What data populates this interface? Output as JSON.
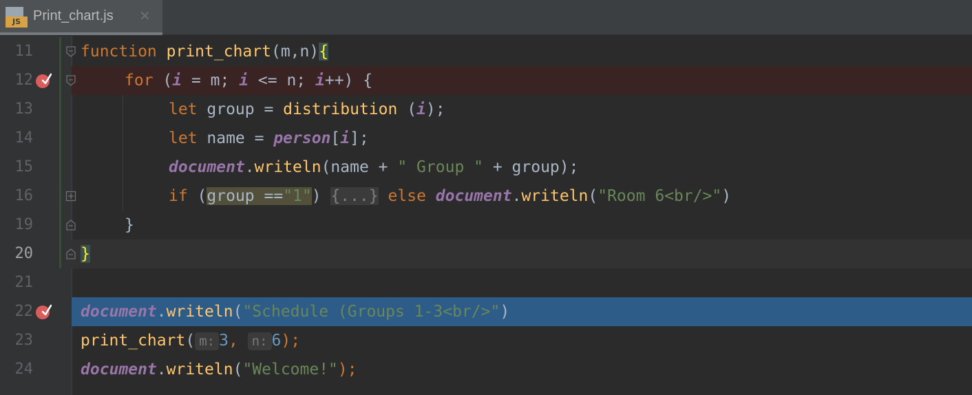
{
  "tab": {
    "title": "Print_chart.js",
    "close": "✕",
    "icon_text": "JS"
  },
  "lines": {
    "l11": {
      "num": "11"
    },
    "l12": {
      "num": "12"
    },
    "l13": {
      "num": "13"
    },
    "l14": {
      "num": "14"
    },
    "l15": {
      "num": "15"
    },
    "l16": {
      "num": "16"
    },
    "l19": {
      "num": "19"
    },
    "l20": {
      "num": "20"
    },
    "l21": {
      "num": "21"
    },
    "l22": {
      "num": "22"
    },
    "l23": {
      "num": "23"
    },
    "l24": {
      "num": "24"
    }
  },
  "code": {
    "l11": {
      "kw": "function",
      "fn": "print_chart",
      "rest": "(m,n)",
      "brace": "{"
    },
    "l12": {
      "kw": "for",
      "p1": " (",
      "v1": "i",
      "p2": " = m; ",
      "v2": "i",
      "p3": " <= n; ",
      "v3": "i",
      "p4": "++) {"
    },
    "l13": {
      "kw": "let",
      "p1": " group = ",
      "fn": "distribution",
      "p2": " (",
      "v": "i",
      "p3": ");"
    },
    "l14": {
      "kw": "let",
      "p1": " name = ",
      "v1": "person",
      "p2": "[",
      "v2": "i",
      "p3": "];"
    },
    "l15": {
      "v": "document",
      "p1": ".",
      "fn": "writeln",
      "p2": "(name + ",
      "str": "\" Group \"",
      "p3": " + group);"
    },
    "l16": {
      "kw": "if",
      "p1": " (",
      "hl": "group ==",
      "str": "\"1\"",
      "p2": ") ",
      "fold": "{...}",
      "p3": " ",
      "kw2": "else",
      "p4": " ",
      "v": "document",
      "p5": ".",
      "fn": "writeln",
      "p6": "(",
      "str2": "\"Room 6<br/>\"",
      "p7": ")"
    },
    "l19": {
      "text": "}"
    },
    "l20": {
      "brace": "}"
    },
    "l22": {
      "v": "document",
      "p1": ".",
      "fn": "writeln",
      "p2": "(",
      "str": "\"Schedule (Groups 1-3<br/>\"",
      "p3": ")"
    },
    "l23": {
      "fn": "print_chart",
      "p1": "(",
      "hint1": "m:",
      "n1": "3",
      "p2": ", ",
      "hint2": "n:",
      "n2": "6",
      "p3": ");"
    },
    "l24": {
      "v": "document",
      "p1": ".",
      "fn": "writeln",
      "p2": "(",
      "str": "\"Welcome!\"",
      "p3": ");"
    }
  },
  "colors": {
    "keyword": "#cc7832",
    "function": "#ffc66d",
    "variable": "#9876aa",
    "string": "#6a8759",
    "number": "#6897bb",
    "breakpoint_line": "#3a2323",
    "execution_line": "#2d5c88"
  },
  "icons": {
    "breakpoint": "breakpoint-check-icon",
    "fold": "fold-icon"
  }
}
